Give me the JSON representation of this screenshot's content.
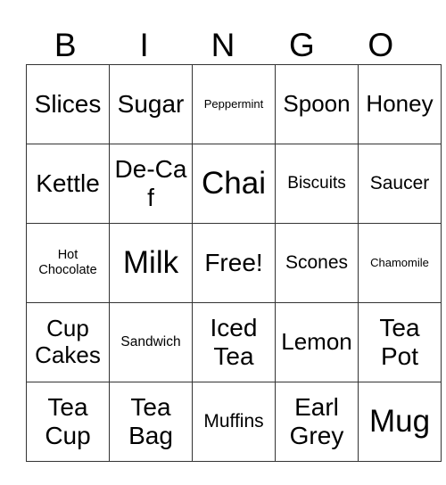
{
  "header": [
    "B",
    "I",
    "N",
    "G",
    "O"
  ],
  "rows": [
    [
      "Slices",
      "Sugar",
      "Peppermint",
      "Spoon",
      "Honey"
    ],
    [
      "Kettle",
      "De-Caf",
      "Chai",
      "Biscuits",
      "Saucer"
    ],
    [
      "Hot Chocolate",
      "Milk",
      "Free!",
      "Scones",
      "Chamomile"
    ],
    [
      "Cup Cakes",
      "Sandwich",
      "Iced Tea",
      "Lemon",
      "Tea Pot"
    ],
    [
      "Tea Cup",
      "Tea Bag",
      "Muffins",
      "Earl Grey",
      "Mug"
    ]
  ]
}
